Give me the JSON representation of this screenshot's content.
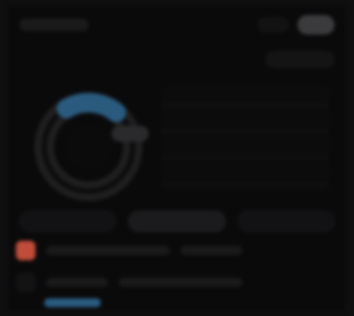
{
  "colors": {
    "accent_red": "#c14c3a",
    "accent_blue": "#2a5b7e",
    "ring_base": "#1f1f20",
    "ring_shadow": "#0b0b0c"
  }
}
